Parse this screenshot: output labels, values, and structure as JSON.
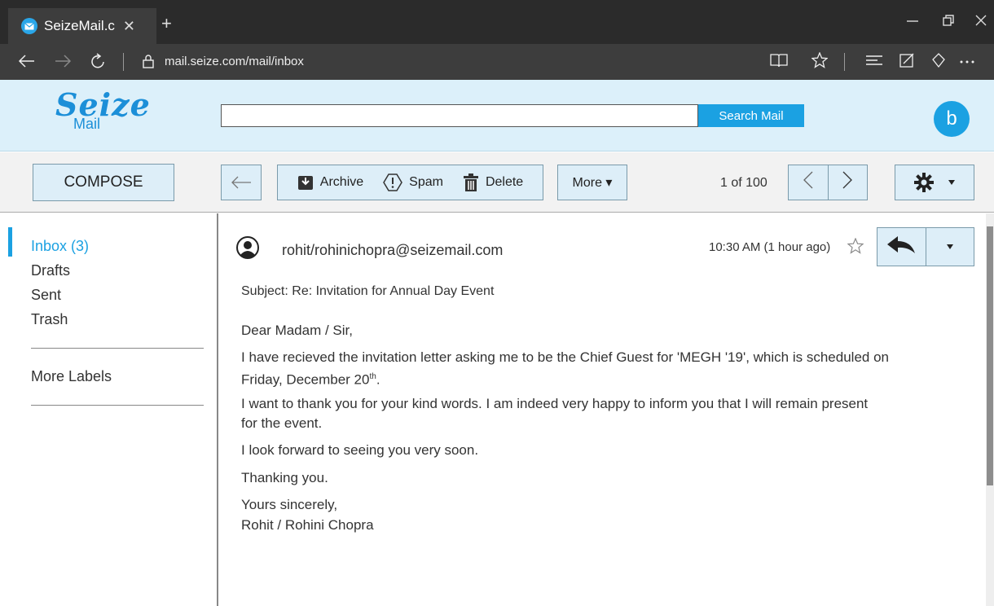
{
  "browser": {
    "tab_title": "SeizeMail.c",
    "tab_close": "✕",
    "new_tab": "+",
    "url": "mail.seize.com/mail/inbox"
  },
  "header": {
    "logo_main": "Seize",
    "logo_sub": "Mail",
    "search_button": "Search Mail",
    "search_value": "",
    "avatar_letter": "b",
    "brand_color": "#1ba1e2"
  },
  "toolbar": {
    "compose": "COMPOSE",
    "archive": "Archive",
    "spam": "Spam",
    "delete": "Delete",
    "more": "More ▾",
    "pager": "1 of 100"
  },
  "sidebar": {
    "items": [
      {
        "label": "Inbox (3)"
      },
      {
        "label": "Drafts"
      },
      {
        "label": "Sent"
      },
      {
        "label": "Trash"
      }
    ],
    "more_labels": "More Labels"
  },
  "message": {
    "sender": "rohit/rohinichopra@seizemail.com",
    "time": "10:30 AM (1 hour ago)",
    "subject": "Subject:  Re:  Invitation for Annual Day Event",
    "greeting": "Dear Madam / Sir,",
    "para1_line1": "I have recieved the invitation letter asking me to be the Chief Guest for 'MEGH '19', which is scheduled on",
    "para1_line2_prefix": "Friday, December  20",
    "para1_line2_sup": "th",
    "para1_line2_suffix": ".",
    "para2_line1": "I want to thank you for your kind words. I am indeed very happy to inform you that I will remain present",
    "para2_line2": "for the event.",
    "para3": "I look forward to seeing you very soon.",
    "para4": "Thanking you.",
    "closing": "Yours sincerely,",
    "signature": "Rohit / Rohini Chopra"
  }
}
